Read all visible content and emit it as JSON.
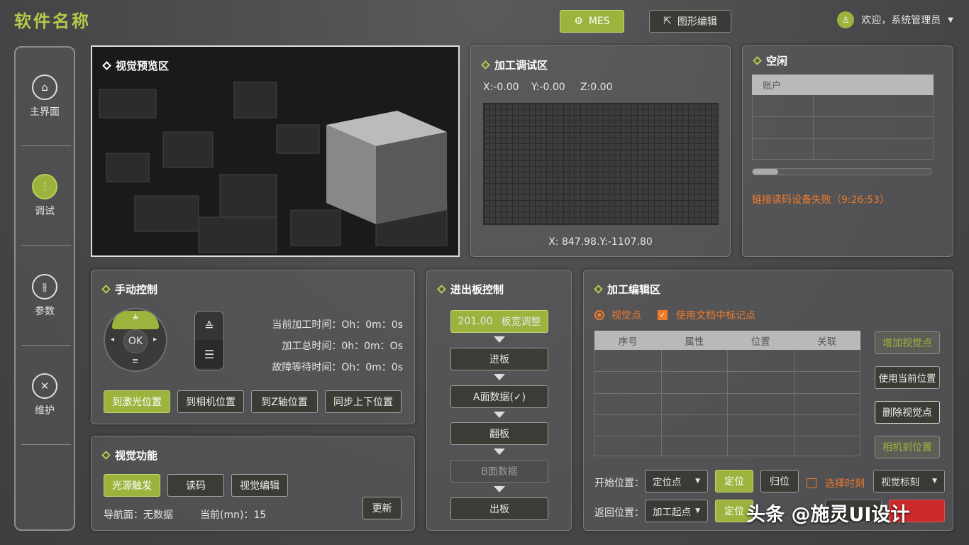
{
  "app_title": "软件名称",
  "header": {
    "mes_label": "MES",
    "graph_edit_label": "图形编辑",
    "welcome": "欢迎，系统管理员"
  },
  "sidebar": {
    "items": [
      {
        "label": "主界面",
        "icon": "home-icon"
      },
      {
        "label": "调试",
        "icon": "sliders-icon"
      },
      {
        "label": "参数",
        "icon": "params-icon"
      },
      {
        "label": "维护",
        "icon": "tools-icon"
      }
    ]
  },
  "preview": {
    "title": "视觉预览区"
  },
  "debug": {
    "title": "加工调试区",
    "x": "X:-0.00",
    "y": "Y:-0.00",
    "z": "Z:0.00",
    "coords": "X: 847.98.Y:-1107.80"
  },
  "idle": {
    "title": "空闲",
    "table_header": "账户",
    "error": "链接读码设备失败（9:26:53）"
  },
  "manual": {
    "title": "手动控制",
    "ok": "OK",
    "cur_time_label": "当前加工时间：",
    "cur_time_value": "Oh：0m：0s",
    "total_time_label": "加工总时间：",
    "total_time_value": "0h：0m：Os",
    "fault_label": "故障等待时间：",
    "fault_value": "Oh：0m：0s",
    "buttons": [
      "到激光位置",
      "到相机位置",
      "到Z轴位置",
      "同步上下位置"
    ]
  },
  "vision": {
    "title": "视觉功能",
    "buttons": [
      "光源触发",
      "读码",
      "视觉编辑"
    ],
    "update": "更新",
    "nav_label": "导航面：",
    "nav_value": "无数据",
    "current_label": "当前(mn)：",
    "current_value": "15"
  },
  "board": {
    "title": "进出板控制",
    "first_value": "201.00",
    "first_label": "板宽调整",
    "steps": [
      "进板",
      "A面数据(✓)",
      "翻板",
      "B面数据",
      "出板"
    ]
  },
  "edit": {
    "title": "加工编辑区",
    "radio_label": "视觉点",
    "check_label": "使用文档中标记点",
    "columns": [
      "序号",
      "属性",
      "位置",
      "关联"
    ],
    "side_buttons": [
      "增加视觉点",
      "使用当前位置",
      "删除视觉点",
      "相机到位置"
    ],
    "start_label": "开始位置：",
    "start_select": "定位点",
    "locate": "定位",
    "home": "归位",
    "select_time_label": "选择时刻",
    "vision_mark": "视觉标刻",
    "return_label": "返回位置：",
    "return_select": "加工起点",
    "locate2": "定位"
  },
  "watermark": "头条 @施灵UI设计",
  "colors": {
    "accent": "#9cb33e",
    "error": "#f07a2a",
    "bg": "#4a4a4c"
  }
}
